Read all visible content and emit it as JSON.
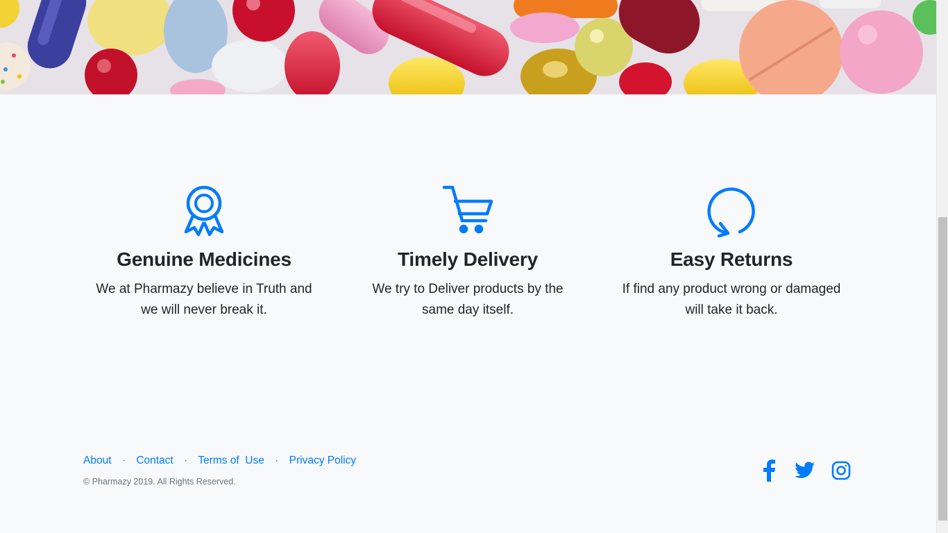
{
  "hero": {
    "image": "colorful-pills-photo"
  },
  "features": [
    {
      "icon": "award-ribbon-icon",
      "title": "Genuine Medicines",
      "line1": "We at Pharmazy believe in Truth and",
      "line2": "we will never break it."
    },
    {
      "icon": "shopping-cart-icon",
      "title": "Timely Delivery",
      "line1": "We try to Deliver products by the",
      "line2": "same day itself."
    },
    {
      "icon": "refresh-arrow-icon",
      "title": "Easy Returns",
      "line1": "If find any product wrong or damaged",
      "line2": "will take it back."
    }
  ],
  "footer": {
    "links": [
      "About",
      "Contact",
      "Terms of  Use",
      "Privacy Policy"
    ],
    "separator": "·",
    "copyright": "© Pharmazy 2019. All Rights Reserved.",
    "social": [
      "facebook-icon",
      "twitter-icon",
      "instagram-icon"
    ]
  },
  "colors": {
    "accent": "#007bff",
    "text": "#212529",
    "muted": "#6c757d",
    "background": "#f8f9fa"
  }
}
